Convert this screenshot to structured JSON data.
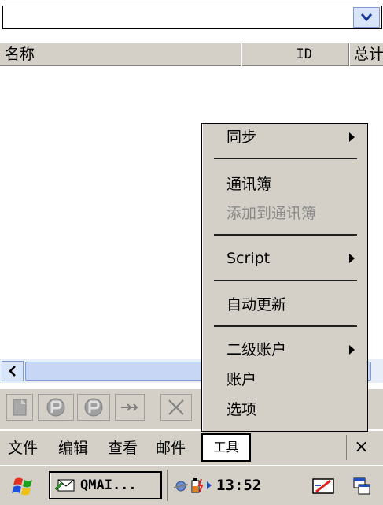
{
  "combo": {
    "value": "",
    "arrow_icon": "chevron-down-icon"
  },
  "columns": {
    "name": "名称",
    "id": "ID",
    "total": "总计"
  },
  "menubar": {
    "items": [
      "文件",
      "编辑",
      "查看",
      "邮件",
      "工具"
    ],
    "close": "×"
  },
  "dropdown": {
    "items": [
      {
        "label": "同步",
        "submenu": true,
        "enabled": true
      },
      {
        "label": "通讯簿",
        "submenu": false,
        "enabled": true
      },
      {
        "label": "添加到通讯簿",
        "submenu": false,
        "enabled": false
      },
      {
        "label": "Script",
        "submenu": true,
        "enabled": true
      },
      {
        "label": "自动更新",
        "submenu": false,
        "enabled": true
      },
      {
        "label": "二级账户",
        "submenu": true,
        "enabled": true
      },
      {
        "label": "账户",
        "submenu": false,
        "enabled": true
      },
      {
        "label": "选项",
        "submenu": false,
        "enabled": true
      }
    ]
  },
  "taskbar": {
    "task_label": "QMAI...",
    "clock": "13:52"
  },
  "colors": {
    "accent": "#7e9bd4",
    "chrome": "#d4d0c8",
    "scroll": "#c6d6f4"
  }
}
